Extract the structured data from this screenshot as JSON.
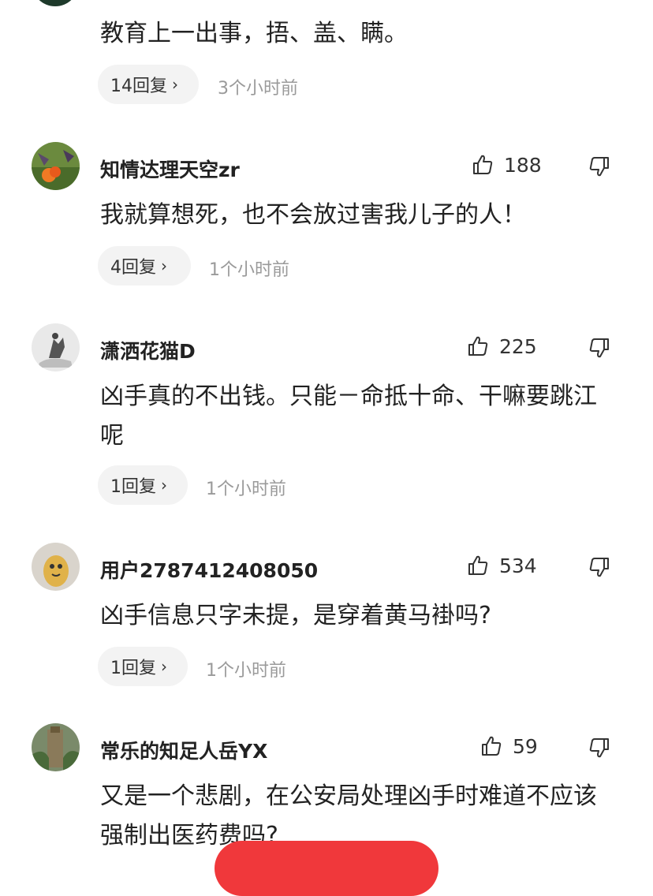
{
  "comments": [
    {
      "username": "",
      "text": "教育上一出事，捂、盖、瞒。",
      "replies": "14回复",
      "time": "3个小时前"
    },
    {
      "username": "知情达理天空zr",
      "likes": "188",
      "text": "我就算想死，也不会放过害我儿子的人！",
      "replies": "4回复",
      "time": "1个小时前"
    },
    {
      "username": "潇洒花猫D",
      "likes": "225",
      "text": "凶手真的不出钱。只能－命抵十命、干嘛要跳江呢",
      "replies": "1回复",
      "time": "1个小时前"
    },
    {
      "username": "用户2787412408050",
      "likes": "534",
      "text": "凶手信息只字未提，是穿着黄马褂吗?",
      "replies": "1回复",
      "time": "1个小时前"
    },
    {
      "username": "常乐的知足人岳YX",
      "likes": "59",
      "text": "又是一个悲剧，在公安局处理凶手时难道不应该强制出医药费吗?",
      "replies": "",
      "time": ""
    }
  ],
  "icons": {
    "like": "thumbs-up-icon",
    "dislike": "thumbs-down-icon",
    "chevron": "chevron-right-icon"
  },
  "colors": {
    "accent": "#f0383b",
    "pill_bg": "#f3f3f3",
    "time_text": "#9a9a9a"
  }
}
